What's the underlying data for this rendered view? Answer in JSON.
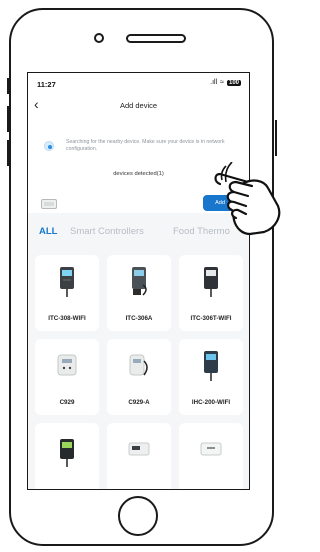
{
  "status_bar": {
    "time": "11:27",
    "signal": ".ıll",
    "wifi": "≈",
    "battery": "100"
  },
  "nav": {
    "back_label": "‹",
    "title": "Add device"
  },
  "search": {
    "message": "Searching for the nearby device. Make sure your device is in network configuration.",
    "detected": "devices detected(1)"
  },
  "add_button": {
    "label": "Add"
  },
  "tabs": [
    {
      "label": "ALL"
    },
    {
      "label": "Smart Controllers"
    },
    {
      "label": "Food Thermo"
    }
  ],
  "devices": [
    {
      "name": "ITC-308-WIFI"
    },
    {
      "name": "ITC-306A"
    },
    {
      "name": "ITC-306T-WIFI"
    },
    {
      "name": "C929"
    },
    {
      "name": "C929-A"
    },
    {
      "name": "IHC-200-WIFI"
    },
    {
      "name": ""
    },
    {
      "name": ""
    },
    {
      "name": ""
    }
  ],
  "colors": {
    "accent": "#1877cc",
    "active_tab": "#1877cc",
    "inactive_tab": "#b7bdc5"
  }
}
